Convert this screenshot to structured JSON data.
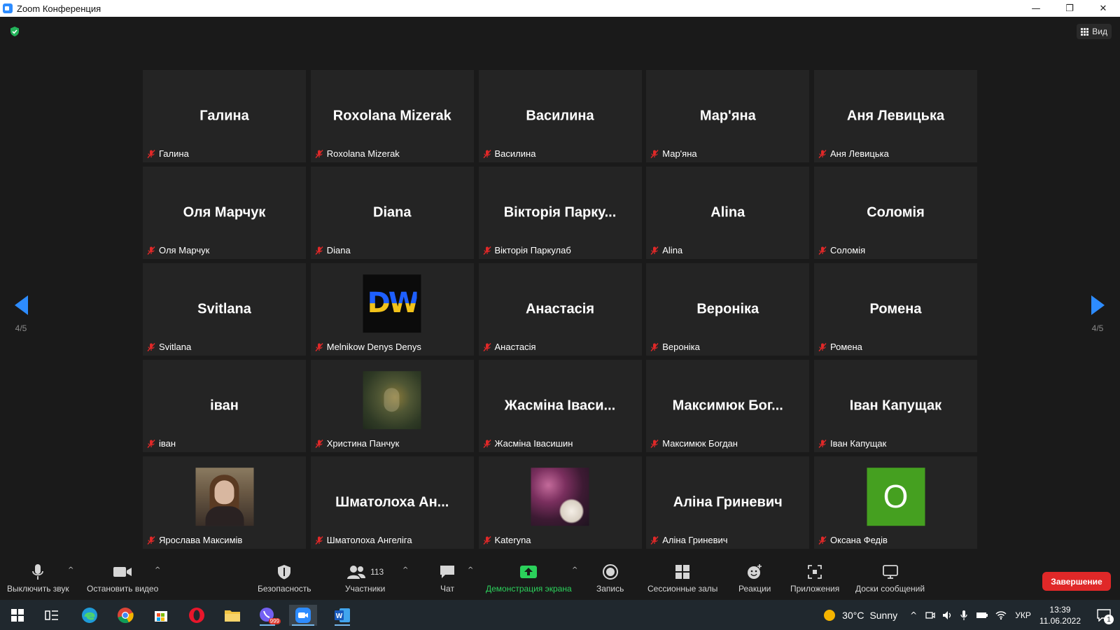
{
  "window": {
    "title": "Zoom Конференция"
  },
  "top": {
    "view_label": "Вид"
  },
  "pager": {
    "left": "4/5",
    "right": "4/5"
  },
  "tiles": [
    {
      "big": "Галина",
      "label": "Галина"
    },
    {
      "big": "Roxolana Mizerak",
      "label": "Roxolana Mizerak"
    },
    {
      "big": "Василина",
      "label": "Василина"
    },
    {
      "big": "Мар'яна",
      "label": "Мар'яна"
    },
    {
      "big": "Аня Левицька",
      "label": "Аня Левицька"
    },
    {
      "big": "Оля Марчук",
      "label": "Оля Марчук"
    },
    {
      "big": "Diana",
      "label": "Diana"
    },
    {
      "big": "Вікторія Парку...",
      "label": "Вікторія Паркулаб"
    },
    {
      "big": "Alina",
      "label": "Alina"
    },
    {
      "big": "Соломія",
      "label": "Соломія"
    },
    {
      "big": "Svitlana",
      "label": "Svitlana"
    },
    {
      "big": "",
      "label": "Melnikow Denys Denys",
      "avatar_text": "DW"
    },
    {
      "big": "Анастасія",
      "label": "Анастасія"
    },
    {
      "big": "Вероніка",
      "label": "Вероніка"
    },
    {
      "big": "Ромена",
      "label": "Ромена"
    },
    {
      "big": "іван",
      "label": "іван"
    },
    {
      "big": "",
      "label": "Христина Панчук"
    },
    {
      "big": "Жасміна Іваси...",
      "label": "Жасміна Івасишин"
    },
    {
      "big": "Максимюк Бог...",
      "label": "Максимюк Богдан"
    },
    {
      "big": "Іван Капущак",
      "label": "Іван Капущак"
    },
    {
      "big": "",
      "label": "Ярослава Максимів"
    },
    {
      "big": "Шматолоха Ан...",
      "label": "Шматолоха Ангеліга"
    },
    {
      "big": "",
      "label": "Kateryna"
    },
    {
      "big": "Аліна Гриневич",
      "label": "Аліна Гриневич"
    },
    {
      "big": "",
      "label": "Оксана Федів",
      "avatar_text": "O",
      "avatar_color": "#45a020"
    }
  ],
  "toolbar": {
    "mute": "Выключить звук",
    "video": "Остановить видео",
    "security": "Безопасность",
    "participants": "Участники",
    "participants_count": "113",
    "chat": "Чат",
    "share": "Демонстрация экрана",
    "record": "Запись",
    "breakout": "Сессионные залы",
    "reactions": "Реакции",
    "apps": "Приложения",
    "whiteboards": "Доски сообщений",
    "end": "Завершение"
  },
  "taskbar": {
    "weather_temp": "30°C",
    "weather_text": "Sunny",
    "lang": "УКР",
    "time": "13:39",
    "date": "11.06.2022",
    "viber_badge": "999",
    "notif_count": "1"
  },
  "colors": {
    "accent": "#2d8cff",
    "end": "#e02828",
    "share": "#2bd15b",
    "muted": "#e02828"
  }
}
